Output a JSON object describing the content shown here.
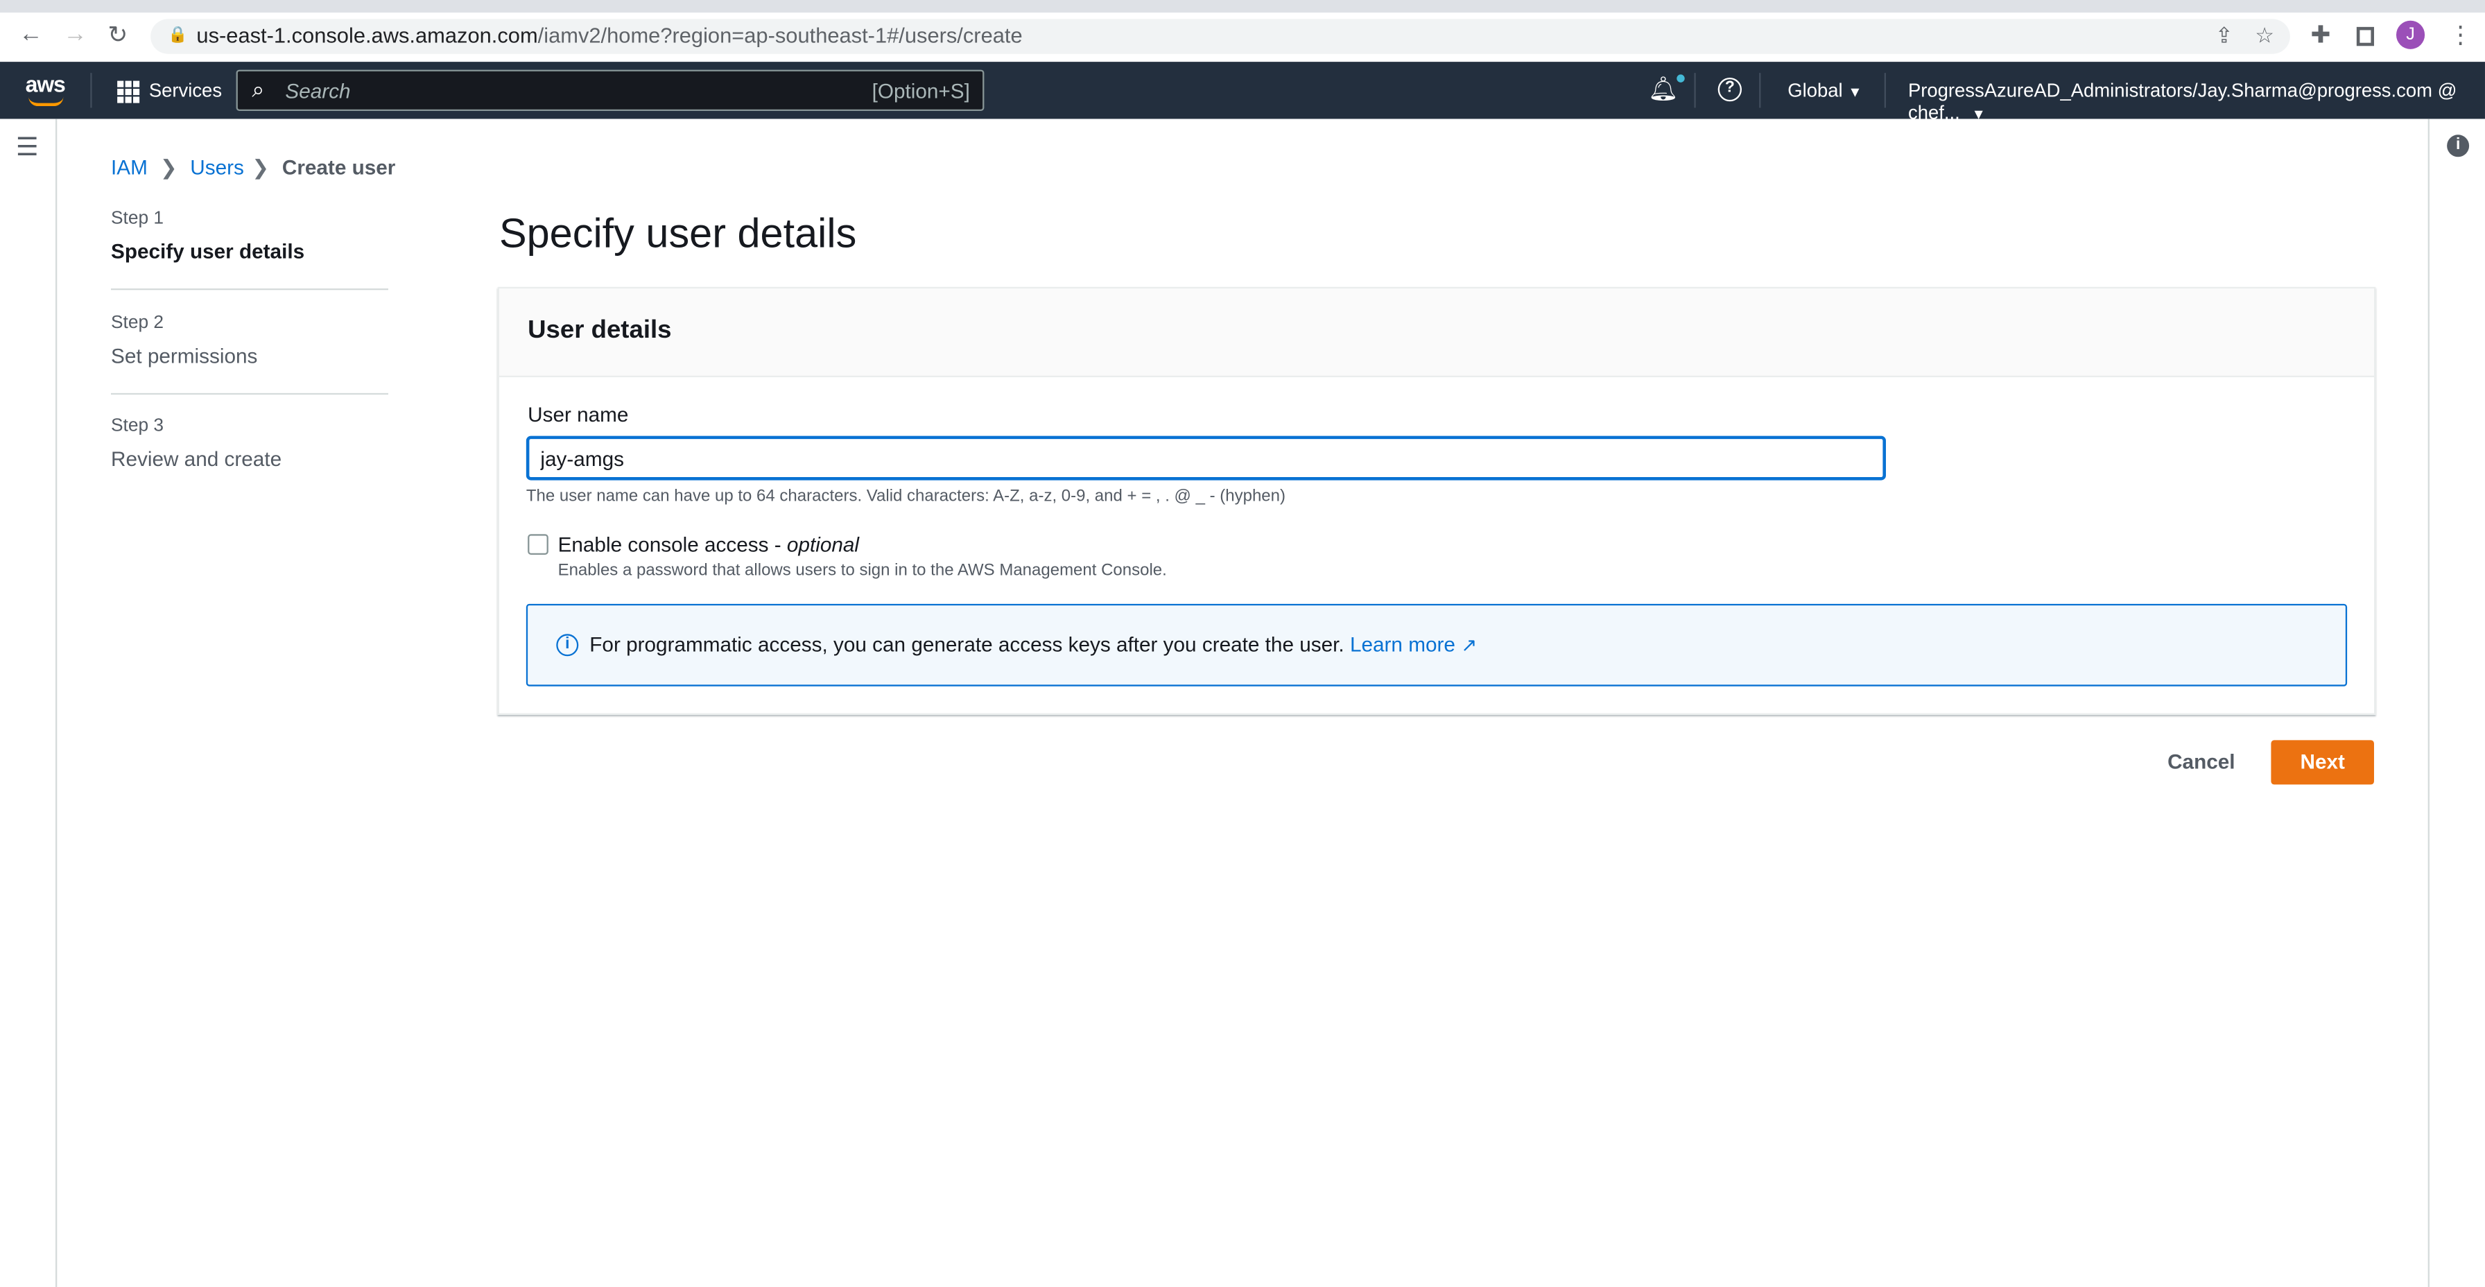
{
  "browser": {
    "url_host": "us-east-1.console.aws.amazon.com",
    "url_path": "/iamv2/home?region=ap-southeast-1#/users/create",
    "avatar_letter": "J"
  },
  "nav": {
    "logo": "aws",
    "services": "Services",
    "search_placeholder": "Search",
    "search_shortcut": "[Option+S]",
    "region": "Global",
    "account": "ProgressAzureAD_Administrators/Jay.Sharma@progress.com @ chef..."
  },
  "breadcrumb": [
    "IAM",
    "Users",
    "Create user"
  ],
  "steps": [
    {
      "label": "Step 1",
      "name": "Specify user details"
    },
    {
      "label": "Step 2",
      "name": "Set permissions"
    },
    {
      "label": "Step 3",
      "name": "Review and create"
    }
  ],
  "page_title": "Specify user details",
  "card": {
    "title": "User details",
    "username_label": "User name",
    "username_value": "jay-amgs",
    "username_hint": "The user name can have up to 64 characters. Valid characters: A-Z, a-z, 0-9, and + = , . @ _ - (hyphen)",
    "console_label": "Enable console access - ",
    "console_optional": "optional",
    "console_checked": false,
    "console_desc": "Enables a password that allows users to sign in to the AWS Management Console.",
    "info_text": "For programmatic access, you can generate access keys after you create the user.",
    "learn_more": "Learn more"
  },
  "actions": {
    "cancel": "Cancel",
    "next": "Next"
  },
  "colors": {
    "nav_bg": "#232f3e",
    "link": "#0972d3",
    "primary": "#ec7211"
  }
}
